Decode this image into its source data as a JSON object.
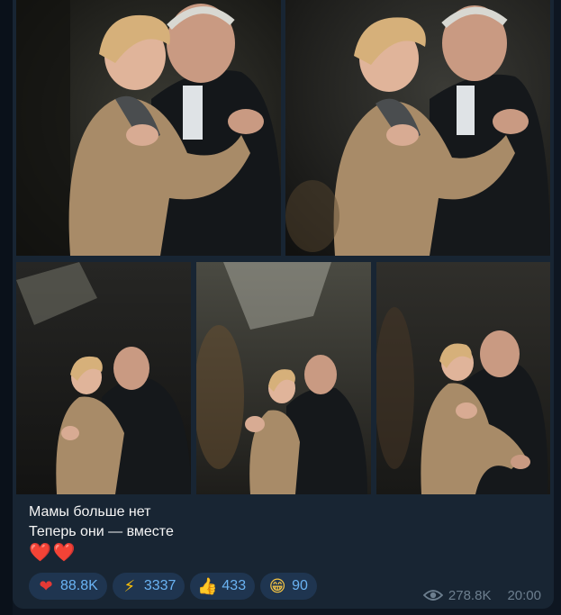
{
  "post": {
    "caption_line1": "Мамы больше нет",
    "caption_line2": "Теперь они — вместе",
    "caption_hearts": [
      "❤️",
      "❤️"
    ],
    "views": "278.8K",
    "time": "20:00"
  },
  "reactions": [
    {
      "icon": "heart-icon",
      "emoji": "❤",
      "count": "88.8K"
    },
    {
      "icon": "lightning-icon",
      "emoji": "⚡",
      "count": "3337"
    },
    {
      "icon": "thumbs-up-icon",
      "emoji": "👍",
      "count": "433"
    },
    {
      "icon": "grinning-face-icon",
      "emoji": "😁",
      "count": "90"
    }
  ],
  "colors": {
    "background": "#0e1621",
    "bubble": "#182533",
    "reaction_bg": "#1f3550",
    "reaction_text": "#6ab3f3",
    "meta_text": "#6d7f8f"
  }
}
